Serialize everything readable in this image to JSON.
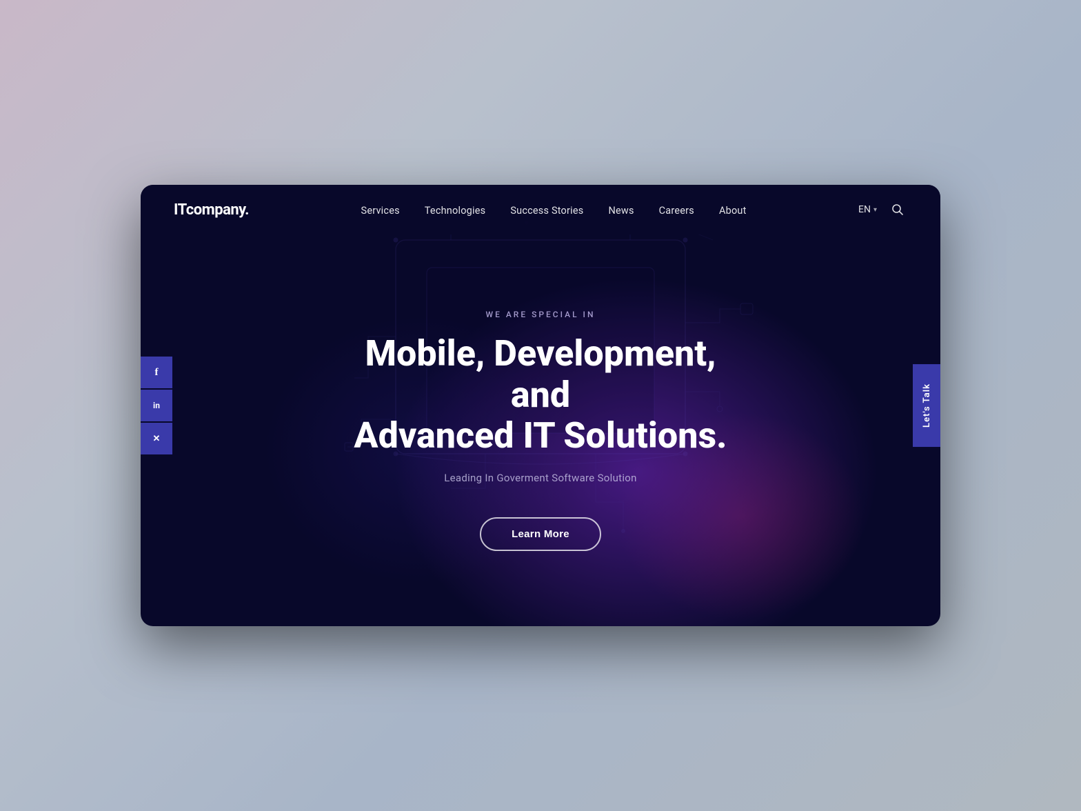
{
  "page": {
    "background_color": "#b0b8c4"
  },
  "browser": {
    "background": "#08082a"
  },
  "navbar": {
    "logo": "ITcompany.",
    "links": [
      {
        "label": "Services",
        "id": "services"
      },
      {
        "label": "Technologies",
        "id": "technologies"
      },
      {
        "label": "Success Stories",
        "id": "success-stories"
      },
      {
        "label": "News",
        "id": "news"
      },
      {
        "label": "Careers",
        "id": "careers"
      },
      {
        "label": "About",
        "id": "about"
      }
    ],
    "language": "EN",
    "language_chevron": "▾",
    "search_icon": "🔍"
  },
  "hero": {
    "eyebrow": "WE ARE SPECIAL IN",
    "title_line1": "Mobile, Development, and",
    "title_line2": "Advanced IT Solutions.",
    "subtitle": "Leading In Goverment Software Solution",
    "cta_label": "Learn More"
  },
  "social": {
    "facebook_icon": "f",
    "linkedin_icon": "in",
    "twitter_icon": "𝕏"
  },
  "lets_talk": {
    "label": "Let's Talk"
  }
}
